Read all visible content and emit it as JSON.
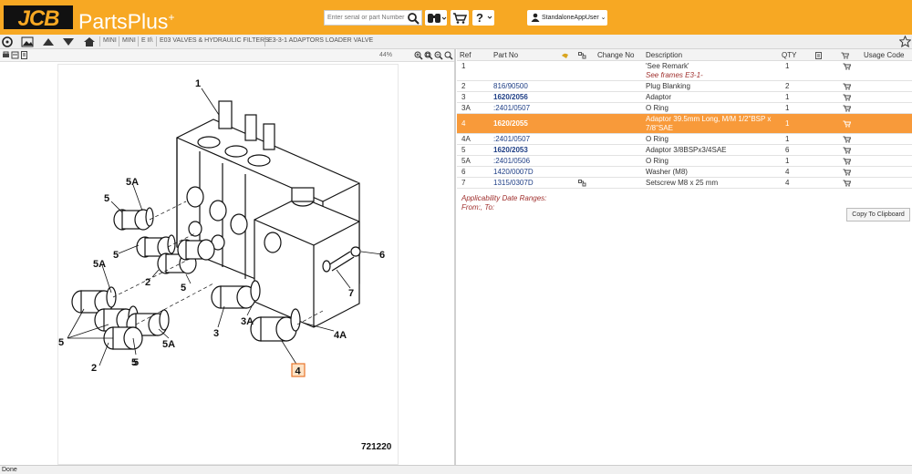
{
  "header": {
    "logo_text": "JCB",
    "app_name": "PartsPlus",
    "search_placeholder": "Enter serial or part Number",
    "user_label": "StandaloneAppUser"
  },
  "breadcrumb": [
    "MINI",
    "MINI",
    "E II\\",
    "E03 VALVES & HYDRAULIC FILTERS",
    "E3-3-1 ADAPTORS LOADER VALVE"
  ],
  "viewer": {
    "zoom": "44%",
    "diagram_number": "721220",
    "callouts": [
      "1",
      "5A",
      "5",
      "5",
      "5A",
      "2",
      "5",
      "5",
      "5",
      "2",
      "5",
      "5A",
      "3",
      "3A",
      "4",
      "4A",
      "7",
      "6"
    ]
  },
  "parts": {
    "columns": [
      "Ref",
      "Part No",
      "Change No",
      "Description",
      "QTY",
      "Usage Code"
    ],
    "rows": [
      {
        "ref": "1",
        "part": "",
        "desc": "'See Remark'",
        "remark": "See frames E3-1-",
        "qty": "1"
      },
      {
        "ref": "2",
        "part": "816/90500",
        "desc": "Plug Blanking",
        "qty": "2"
      },
      {
        "ref": "3",
        "part": "1620/2056",
        "desc": "Adaptor",
        "qty": "1",
        "bold": true
      },
      {
        "ref": "3A",
        "part": ":2401/0507",
        "desc": "O Ring",
        "qty": "1"
      },
      {
        "ref": "4",
        "part": "1620/2055",
        "desc": "Adaptor 39.5mm Long, M/M 1/2\"BSP x",
        "desc2": "7/8\"SAE",
        "qty": "1",
        "bold": true,
        "selected": true
      },
      {
        "ref": "4A",
        "part": ":2401/0507",
        "desc": "O Ring",
        "qty": "1"
      },
      {
        "ref": "5",
        "part": "1620/2053",
        "desc": "Adaptor 3/8BSPx3/4SAE",
        "qty": "6",
        "bold": true
      },
      {
        "ref": "5A",
        "part": ":2401/0506",
        "desc": "O Ring",
        "qty": "1"
      },
      {
        "ref": "6",
        "part": "1420/0007D",
        "desc": "Washer (M8)",
        "qty": "4"
      },
      {
        "ref": "7",
        "part": "1315/0307D",
        "desc": "Setscrew M8 x 25 mm",
        "qty": "4",
        "change_icon": true
      }
    ],
    "applicability_title": "Applicability Date Ranges:",
    "applicability_value": "From:, To:",
    "copy_button": "Copy To Clipboard"
  },
  "status": "Done",
  "colors": {
    "brand": "#f7a823",
    "selected_row": "#f89a3a",
    "link": "#1f3f86",
    "remark": "#a0302e"
  }
}
